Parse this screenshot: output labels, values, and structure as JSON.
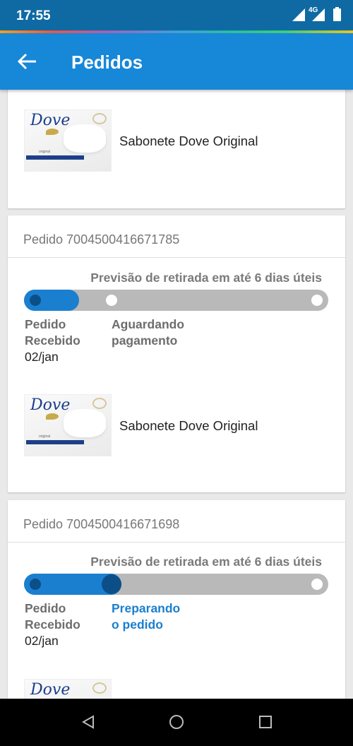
{
  "status_bar": {
    "time": "17:55",
    "network": "4G"
  },
  "app_bar": {
    "title": "Pedidos",
    "back_icon": "arrow-left-icon"
  },
  "orders": [
    {
      "product_name": "Sabonete Dove Original",
      "brand": "Dove",
      "variant": "original"
    },
    {
      "order_label": "Pedido 7004500416671785",
      "forecast": "Previsão de retirada em até 6 dias úteis",
      "progress": 0.18,
      "steps": [
        {
          "line1": "Pedido",
          "line2": "Recebido",
          "date": "02/jan"
        },
        {
          "line1": "Aguardando",
          "line2": "pagamento"
        }
      ],
      "product_name": "Sabonete Dove Original",
      "brand": "Dove",
      "variant": "original"
    },
    {
      "order_label": "Pedido 7004500416671698",
      "forecast": "Previsão de retirada em até 6 dias úteis",
      "progress": 0.32,
      "steps": [
        {
          "line1": "Pedido",
          "line2": "Recebido",
          "date": "02/jan"
        },
        {
          "line1": "Preparando",
          "line2": "o pedido"
        }
      ],
      "brand": "Dove"
    }
  ],
  "colors": {
    "primary": "#1787d8",
    "status_bar": "#0f6aa3",
    "progress_fill": "#1a7fcf",
    "progress_track": "#b9b9b9"
  },
  "nav": {
    "icons": [
      "back-triangle-icon",
      "home-circle-icon",
      "recents-square-icon"
    ]
  }
}
